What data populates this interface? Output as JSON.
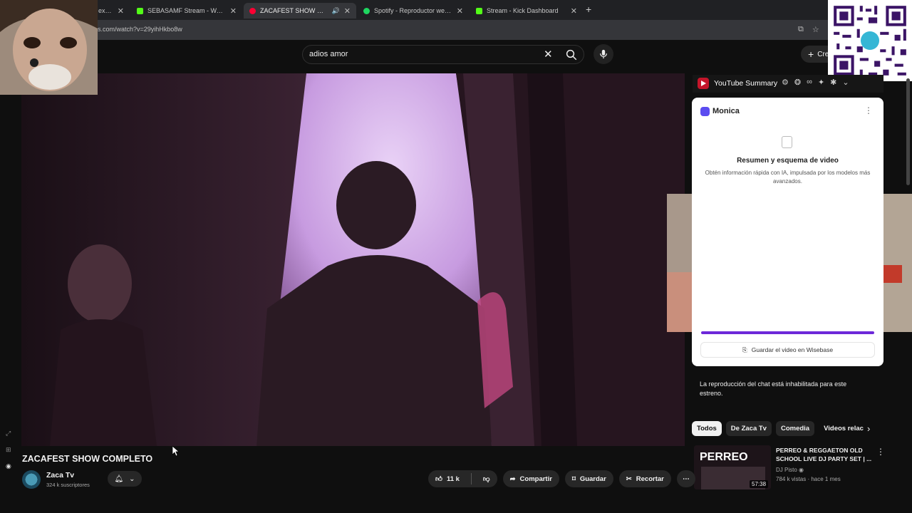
{
  "browser": {
    "tabs": [
      {
        "title": "exofic",
        "color": "#888888",
        "active": false
      },
      {
        "title": "SEBASAMF Stream - Watch Live",
        "color": "#53fc18",
        "active": false
      },
      {
        "title": "ZACAFEST SHOW COMPLETO",
        "color": "#ff0033",
        "active": true
      },
      {
        "title": "Spotify - Reproductor web: mú",
        "color": "#1ed760",
        "active": false
      },
      {
        "title": "Stream - Kick Dashboard",
        "color": "#53fc18",
        "active": false
      }
    ],
    "url": "s.com/watch?v=29yihHkbo8w"
  },
  "youtube": {
    "search_value": "adios amor",
    "create_label": "Cre"
  },
  "extension": {
    "title": "YouTube Summary"
  },
  "monica": {
    "title": "Monica",
    "summary_title": "Resumen y esquema de video",
    "summary_desc": "Obtén información rápida con IA, impulsada por los modelos más avanzados.",
    "wisebase_label": "Guardar el video en Wisebase"
  },
  "chat_note": "La reproducción del chat está inhabilitada para este estreno.",
  "chips": [
    "Todos",
    "De Zaca Tv",
    "Comedia",
    "Videos relac"
  ],
  "recommendation": {
    "title": "PERREO & REGGAETON OLD SCHOOL LIVE DJ PARTY SET | ...",
    "channel": "DJ Pisto",
    "meta": "784 k vistas · hace 1 mes",
    "duration": "57:38",
    "thumb_text": "PERREO"
  },
  "video": {
    "title": "ZACAFEST SHOW COMPLETO",
    "channel": "Zaca Tv",
    "subscribers": "324 k suscriptores",
    "likes": "11 k",
    "share_label": "Compartir",
    "save_label": "Guardar",
    "clip_label": "Recortar"
  },
  "colors": {
    "accent": "#ff0033",
    "monica": "#6d28d9"
  }
}
